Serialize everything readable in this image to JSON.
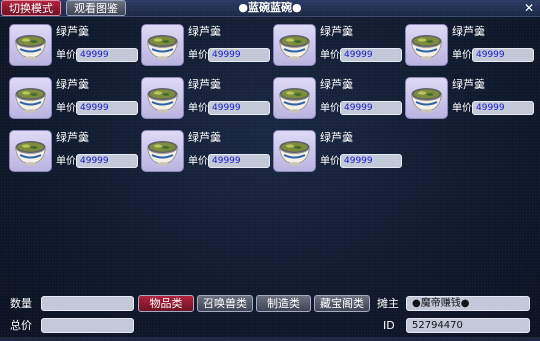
{
  "window": {
    "title": "●蓝碗蓝碗●",
    "close_symbol": "✕"
  },
  "top_buttons": [
    {
      "label": "切换模式",
      "active": true
    },
    {
      "label": "观看图鉴",
      "active": false
    }
  ],
  "items": [
    {
      "name": "绿芦羹",
      "price_label": "单价",
      "price": "49999"
    },
    {
      "name": "绿芦羹",
      "price_label": "单价",
      "price": "49999"
    },
    {
      "name": "绿芦羹",
      "price_label": "单价",
      "price": "49999"
    },
    {
      "name": "绿芦羹",
      "price_label": "单价",
      "price": "49999"
    },
    {
      "name": "绿芦羹",
      "price_label": "单价",
      "price": "49999"
    },
    {
      "name": "绿芦羹",
      "price_label": "单价",
      "price": "49999"
    },
    {
      "name": "绿芦羹",
      "price_label": "单价",
      "price": "49999"
    },
    {
      "name": "绿芦羹",
      "price_label": "单价",
      "price": "49999"
    },
    {
      "name": "绿芦羹",
      "price_label": "单价",
      "price": "49999"
    },
    {
      "name": "绿芦羹",
      "price_label": "单价",
      "price": "49999"
    },
    {
      "name": "绿芦羹",
      "price_label": "单价",
      "price": "49999"
    }
  ],
  "item_icon": "bowl-of-soup-icon",
  "bottom": {
    "quantity_label": "数量",
    "quantity_value": "",
    "total_label": "总价",
    "total_value": "",
    "categories": [
      {
        "label": "物品类",
        "active": true
      },
      {
        "label": "召唤兽类",
        "active": false
      },
      {
        "label": "制造类",
        "active": false
      },
      {
        "label": "藏宝阁类",
        "active": false
      }
    ],
    "owner_label": "摊主",
    "owner_value": "●魔帝赚钱●",
    "id_label": "ID",
    "id_value": "52794470"
  },
  "colors": {
    "active_button": "#b0203a",
    "price_text": "#1a1ac8",
    "background": "#101a2e"
  }
}
